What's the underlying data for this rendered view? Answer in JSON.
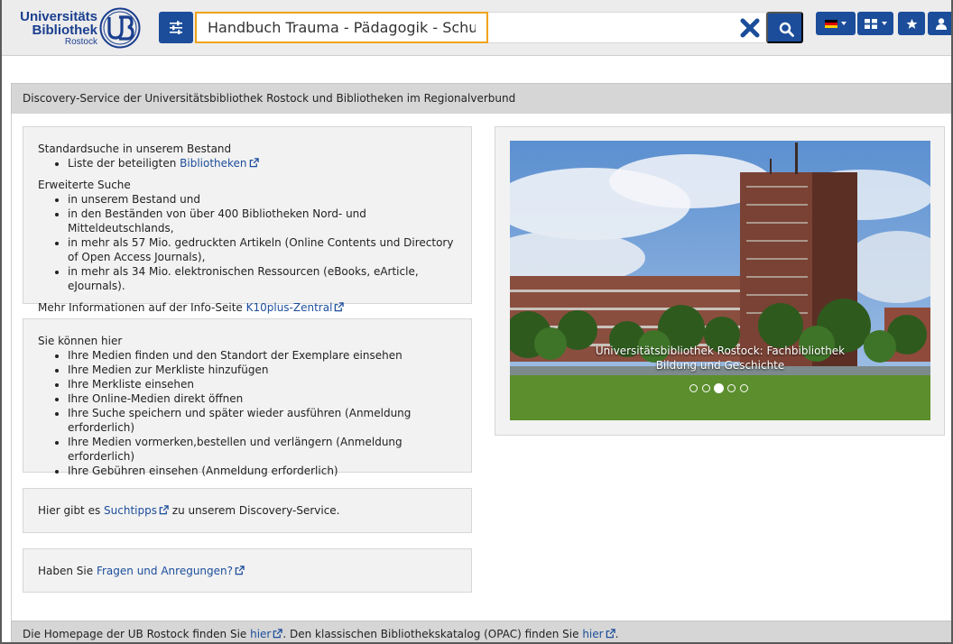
{
  "header": {
    "logo": {
      "line1": "Universitäts",
      "line2": "Bibliothek",
      "line3": "Rostock",
      "seal_letters": "UB"
    },
    "search": {
      "value": "Handbuch Trauma - Pädagogik - Schule",
      "placeholder": ""
    },
    "icons": {
      "filter": "sliders-icon",
      "clear": "close-icon",
      "search": "search-icon",
      "language": "german-flag-icon",
      "grid": "grid-icon",
      "favorites": "star-icon",
      "user": "user-icon"
    },
    "colors": {
      "primary": "#1b4d9a",
      "search_focus": "#f0a318"
    }
  },
  "welcome": {
    "title": "Discovery-Service der Universitätsbibliothek Rostock und Bibliotheken im Regionalverbund"
  },
  "card_search": {
    "standard_heading": "Standardsuche in unserem Bestand",
    "standard_items": [
      {
        "text": "Liste der beteiligten ",
        "link": "Bibliotheken"
      }
    ],
    "extended_heading": "Erweiterte Suche",
    "extended_items": [
      "in unserem Bestand und",
      "in den Beständen von über 400 Bibliotheken Nord- und Mitteldeutschlands,",
      "in mehr als 57 Mio. gedruckten Artikeln (Online Contents und Directory of Open Access Journals),",
      "in mehr als 34 Mio. elektronischen Ressourcen (eBooks, eArticle, eJournals)."
    ],
    "info_text": "Mehr Informationen auf der Info-Seite ",
    "info_link": "K10plus-Zentral"
  },
  "card_features": {
    "heading": "Sie können hier",
    "items": [
      "Ihre Medien finden und den Standort der Exemplare einsehen",
      "Ihre Medien zur Merkliste hinzufügen",
      "Ihre Merkliste einsehen",
      "Ihre Online-Medien direkt öffnen",
      "Ihre Suche speichern und später wieder ausführen (Anmeldung erforderlich)",
      "Ihre Medien vormerken,bestellen und verlängern (Anmeldung erforderlich)",
      "Ihre Gebühren einsehen (Anmeldung erforderlich)"
    ]
  },
  "card_tips": {
    "before": "Hier gibt es ",
    "link": "Suchtipps",
    "after": " zu unserem Discovery-Service."
  },
  "card_feedback": {
    "before": "Haben Sie ",
    "link": "Fragen und Anregungen?"
  },
  "slider": {
    "caption_line1": "Universitätsbibliothek Rostock: Fachbibliothek",
    "caption_line2": "Bildung und Geschichte",
    "slide_count": 5,
    "active_index": 2
  },
  "footer": {
    "t1": "Die Homepage der UB Rostock finden Sie ",
    "link1": "hier",
    "t2": ". Den klassischen Bibliothekskatalog (OPAC) finden Sie ",
    "link2": "hier",
    "t3": "."
  }
}
